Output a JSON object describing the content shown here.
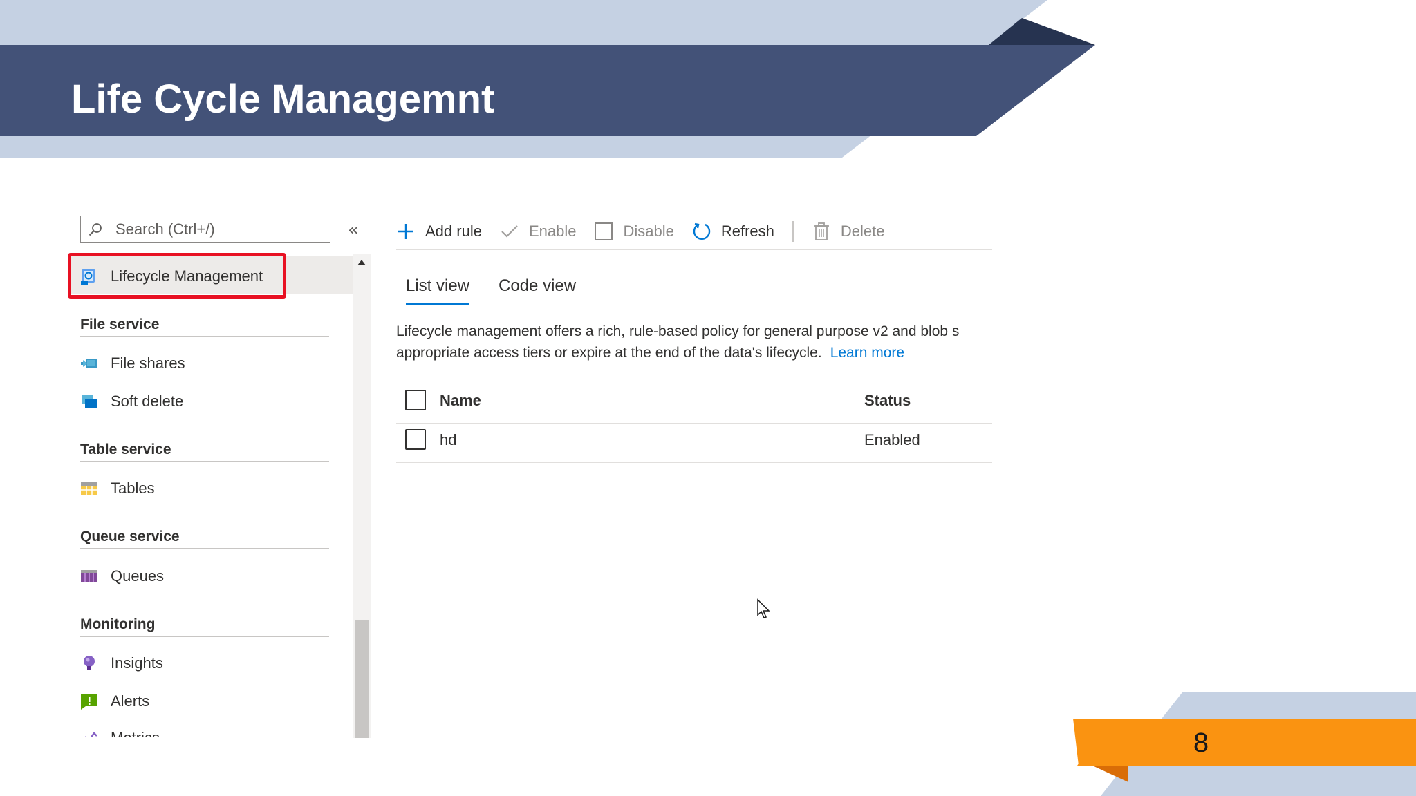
{
  "slide": {
    "title": "Life Cycle Managemnt",
    "page_number": "8",
    "colors": {
      "title_band": "#435278",
      "light_band": "#c5d1e3",
      "dark_accent": "#263350",
      "orange": "#fa9311",
      "orange_dark": "#d96d07"
    }
  },
  "sidebar": {
    "search_placeholder": "Search (Ctrl+/)",
    "collapse_glyph": "«",
    "selected_item": {
      "label": "Lifecycle Management",
      "icon": "lifecycle-icon"
    },
    "sections": [
      {
        "header": "File service",
        "items": [
          {
            "label": "File shares",
            "icon": "file-shares-icon"
          },
          {
            "label": "Soft delete",
            "icon": "soft-delete-icon"
          }
        ]
      },
      {
        "header": "Table service",
        "items": [
          {
            "label": "Tables",
            "icon": "tables-icon"
          }
        ]
      },
      {
        "header": "Queue service",
        "items": [
          {
            "label": "Queues",
            "icon": "queues-icon"
          }
        ]
      },
      {
        "header": "Monitoring",
        "items": [
          {
            "label": "Insights",
            "icon": "insights-icon"
          },
          {
            "label": "Alerts",
            "icon": "alerts-icon"
          },
          {
            "label": "Metrics",
            "icon": "metrics-icon"
          }
        ]
      }
    ]
  },
  "toolbar": {
    "add_rule": "Add rule",
    "enable": "Enable",
    "disable": "Disable",
    "refresh": "Refresh",
    "delete": "Delete"
  },
  "tabs": [
    {
      "label": "List view",
      "active": true
    },
    {
      "label": "Code view",
      "active": false
    }
  ],
  "description": {
    "line1": "Lifecycle management offers a rich, rule-based policy for general purpose v2 and blob s",
    "line2": "appropriate access tiers or expire at the end of the data's lifecycle.",
    "link": "Learn more"
  },
  "grid": {
    "columns": [
      "Name",
      "Status"
    ],
    "rows": [
      {
        "name": "hd",
        "status": "Enabled"
      }
    ]
  }
}
